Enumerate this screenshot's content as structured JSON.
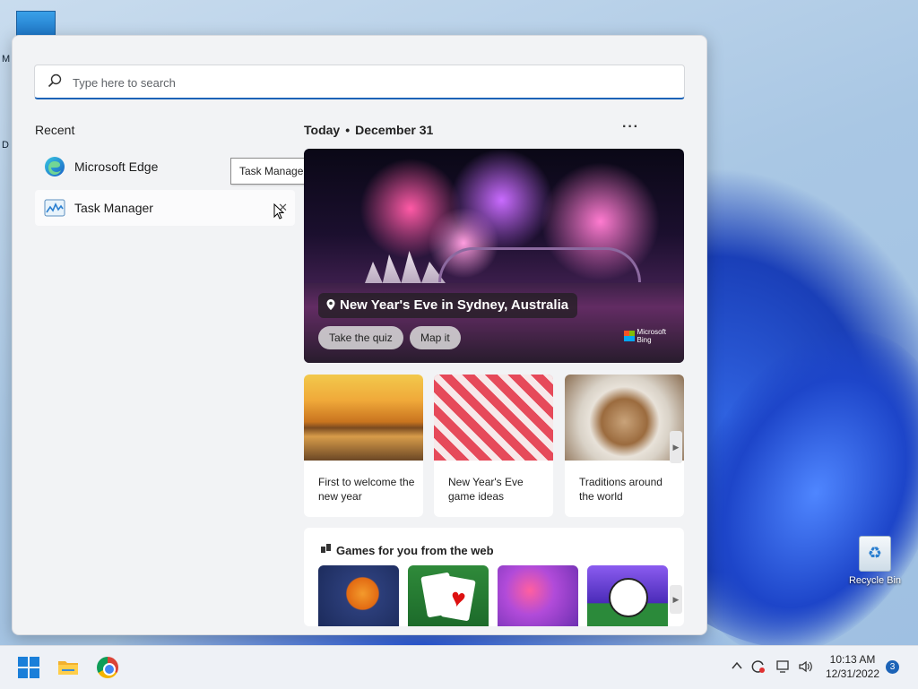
{
  "desktop": {
    "recycle_bin_label": "Recycle Bin",
    "edge_letters": [
      "M",
      "D"
    ]
  },
  "start_menu": {
    "search_placeholder": "Type here to search",
    "recent_heading": "Recent",
    "recent_apps": [
      {
        "name": "Microsoft Edge",
        "icon": "edge-icon"
      },
      {
        "name": "Task Manager",
        "icon": "task-manager-icon",
        "selected": true
      }
    ],
    "tooltip": "Task Manager",
    "remove_glyph": "✕",
    "widgets": {
      "today_label": "Today",
      "separator": "•",
      "date": "December 31",
      "more_label": "···",
      "hero": {
        "caption": "New Year's Eve in Sydney, Australia",
        "quiz_button": "Take the quiz",
        "map_button": "Map it",
        "brand_line1": "Microsoft",
        "brand_line2": "Bing"
      },
      "cards": [
        {
          "text": "First to welcome the new year"
        },
        {
          "text": "New Year's Eve game ideas"
        },
        {
          "text": "Traditions around the world"
        }
      ],
      "games_heading": "Games for you from the web"
    }
  },
  "taskbar": {
    "apps": [
      "start-icon",
      "file-explorer-icon",
      "chrome-icon"
    ],
    "tray": {
      "chevron": "^",
      "speaker": "🔈"
    },
    "time": "10:13 AM",
    "date": "12/31/2022",
    "notification_count": "3"
  },
  "colors": {
    "accent": "#1c63b7",
    "menu_bg": "#f2f3f5",
    "taskbar_bg": "#eef1f6"
  }
}
